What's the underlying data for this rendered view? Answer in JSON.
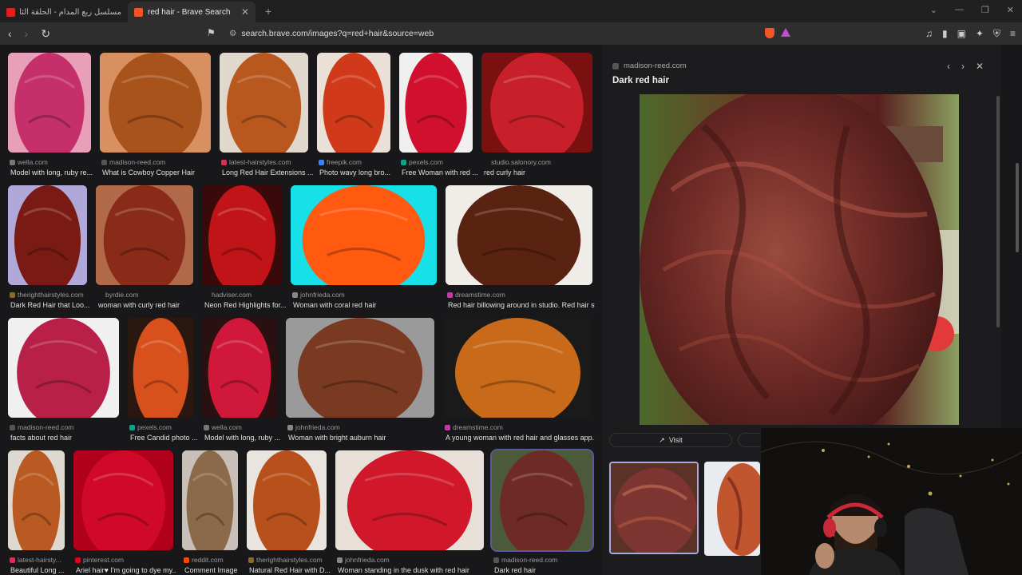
{
  "browser": {
    "tabs": [
      {
        "title": "مسلسل ربع المدام - الحلقة الثانية | الرئ",
        "active": false,
        "favicon_color": "#e02020"
      },
      {
        "title": "red hair - Brave Search",
        "active": true,
        "favicon_color": "#f1562b"
      }
    ],
    "url": "search.brave.com/images?q=red+hair&source=web",
    "icons": [
      "back-icon",
      "forward-icon",
      "reload-icon",
      "bookmark-icon",
      "lock-icon",
      "brave-shield-icon",
      "brave-rewards-icon",
      "music-icon",
      "sidebar-icon",
      "wallet-icon",
      "leo-icon",
      "vpn-icon",
      "menu-icon"
    ]
  },
  "results": [
    {
      "source": "wella.com",
      "caption": "Model with long, ruby re...",
      "fav": "#777"
    },
    {
      "source": "madison-reed.com",
      "caption": "What is Cowboy Copper Hair",
      "fav": "#555"
    },
    {
      "source": "latest-hairstyles.com",
      "caption": "Long Red Hair Extensions ...",
      "fav": "#d8305a"
    },
    {
      "source": "freepik.com",
      "caption": "Photo wavy long bro...",
      "fav": "#3b82f6"
    },
    {
      "source": "pexels.com",
      "caption": "Free Woman with red ...",
      "fav": "#14a085"
    },
    {
      "source": "studio.salonory.com",
      "caption": "red curly hair",
      "fav": "#18181a"
    },
    {
      "source": "therighthairstyles.com",
      "caption": "Dark Red Hair that Loo...",
      "fav": "#8a6a2a"
    },
    {
      "source": "byrdie.com",
      "caption": "woman with curly red hair",
      "fav": "#18181a"
    },
    {
      "source": "hadviser.com",
      "caption": "Neon Red Highlights for...",
      "fav": "#18181a"
    },
    {
      "source": "johnfrieda.com",
      "caption": "Woman with coral red hair",
      "fav": "#888"
    },
    {
      "source": "dreamstime.com",
      "caption": "Red hair billowing around in studio. Red hair st...",
      "fav": "#c13ba8"
    },
    {
      "source": "madison-reed.com",
      "caption": "facts about red hair",
      "fav": "#555"
    },
    {
      "source": "pexels.com",
      "caption": "Free Candid photo ...",
      "fav": "#14a085"
    },
    {
      "source": "wella.com",
      "caption": "Model with long, ruby ...",
      "fav": "#777"
    },
    {
      "source": "johnfrieda.com",
      "caption": "Woman with bright auburn hair",
      "fav": "#888"
    },
    {
      "source": "dreamstime.com",
      "caption": "A young woman with red hair and glasses app...",
      "fav": "#c13ba8"
    },
    {
      "source": "latest-hairsty...",
      "caption": "Beautiful Long ...",
      "fav": "#d8305a"
    },
    {
      "source": "pinterest.com",
      "caption": "Ariel hair♥ I'm going to dye my...",
      "fav": "#e60023"
    },
    {
      "source": "reddit.com",
      "caption": "Comment Image",
      "fav": "#ff4500"
    },
    {
      "source": "therighthairstyles.com",
      "caption": "Natural Red Hair with D...",
      "fav": "#8a6a2a"
    },
    {
      "source": "johnfrieda.com",
      "caption": "Woman standing in the dusk with red hair",
      "fav": "#888"
    },
    {
      "source": "madison-reed.com",
      "caption": "Dark red hair",
      "fav": "#555"
    }
  ],
  "panel": {
    "source": "madison-reed.com",
    "title": "Dark red hair",
    "visit_label": "Visit"
  }
}
